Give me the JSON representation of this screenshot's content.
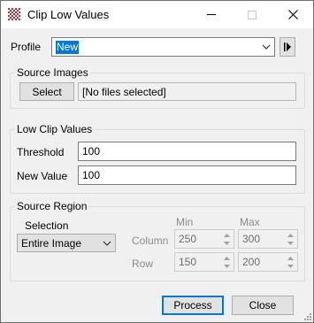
{
  "window": {
    "title": "Clip Low Values",
    "app_icon": "grid-app-icon"
  },
  "profile": {
    "label": "Profile",
    "value": "New"
  },
  "source_images": {
    "group_title": "Source Images",
    "select_button": "Select",
    "files_text": "[No files selected]"
  },
  "low_clip": {
    "group_title": "Low Clip Values",
    "threshold_label": "Threshold",
    "threshold_value": "100",
    "new_value_label": "New Value",
    "new_value_value": "100"
  },
  "source_region": {
    "group_title": "Source Region",
    "selection_label": "Selection",
    "selection_value": "Entire Image",
    "min_label": "Min",
    "max_label": "Max",
    "column_label": "Column",
    "row_label": "Row",
    "column_min": "250",
    "column_max": "300",
    "row_min": "150",
    "row_max": "200"
  },
  "footer": {
    "process_button": "Process",
    "close_button": "Close"
  },
  "colors": {
    "accent": "#0078d7",
    "icon_red": "#c0282d"
  }
}
